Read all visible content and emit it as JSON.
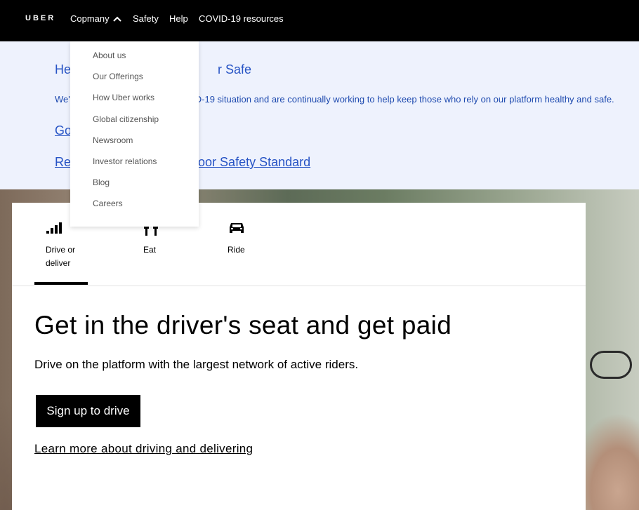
{
  "nav": {
    "logo": "UBER",
    "company": "Copmany",
    "safety": "Safety",
    "help": "Help",
    "covid": "COVID-19 resources"
  },
  "dropdown": {
    "items": [
      "About us",
      "Our Offerings",
      "How Uber works",
      "Global citizenship",
      "Newsroom",
      "Investor relations",
      "Blog",
      "Careers"
    ]
  },
  "banner": {
    "title_left": "He",
    "title_right": "r Safe",
    "text_left": "We'",
    "text_right": "D-19 situation and are continually working to help keep those who rely on our platform healthy and safe.",
    "link1": "Go",
    "link2_left": "Rea",
    "link2_right": "oor Safety Standard"
  },
  "tabs": [
    {
      "label": "Drive or deliver",
      "icon": "signal-bars-icon"
    },
    {
      "label": "Eat",
      "icon": "utensils-icon"
    },
    {
      "label": "Ride",
      "icon": "car-icon"
    }
  ],
  "hero": {
    "headline": "Get in the driver's seat and get paid",
    "subtext": "Drive on the platform with the largest network of active riders.",
    "cta": "Sign up to drive",
    "learn_more": "Learn more about driving and delivering"
  }
}
